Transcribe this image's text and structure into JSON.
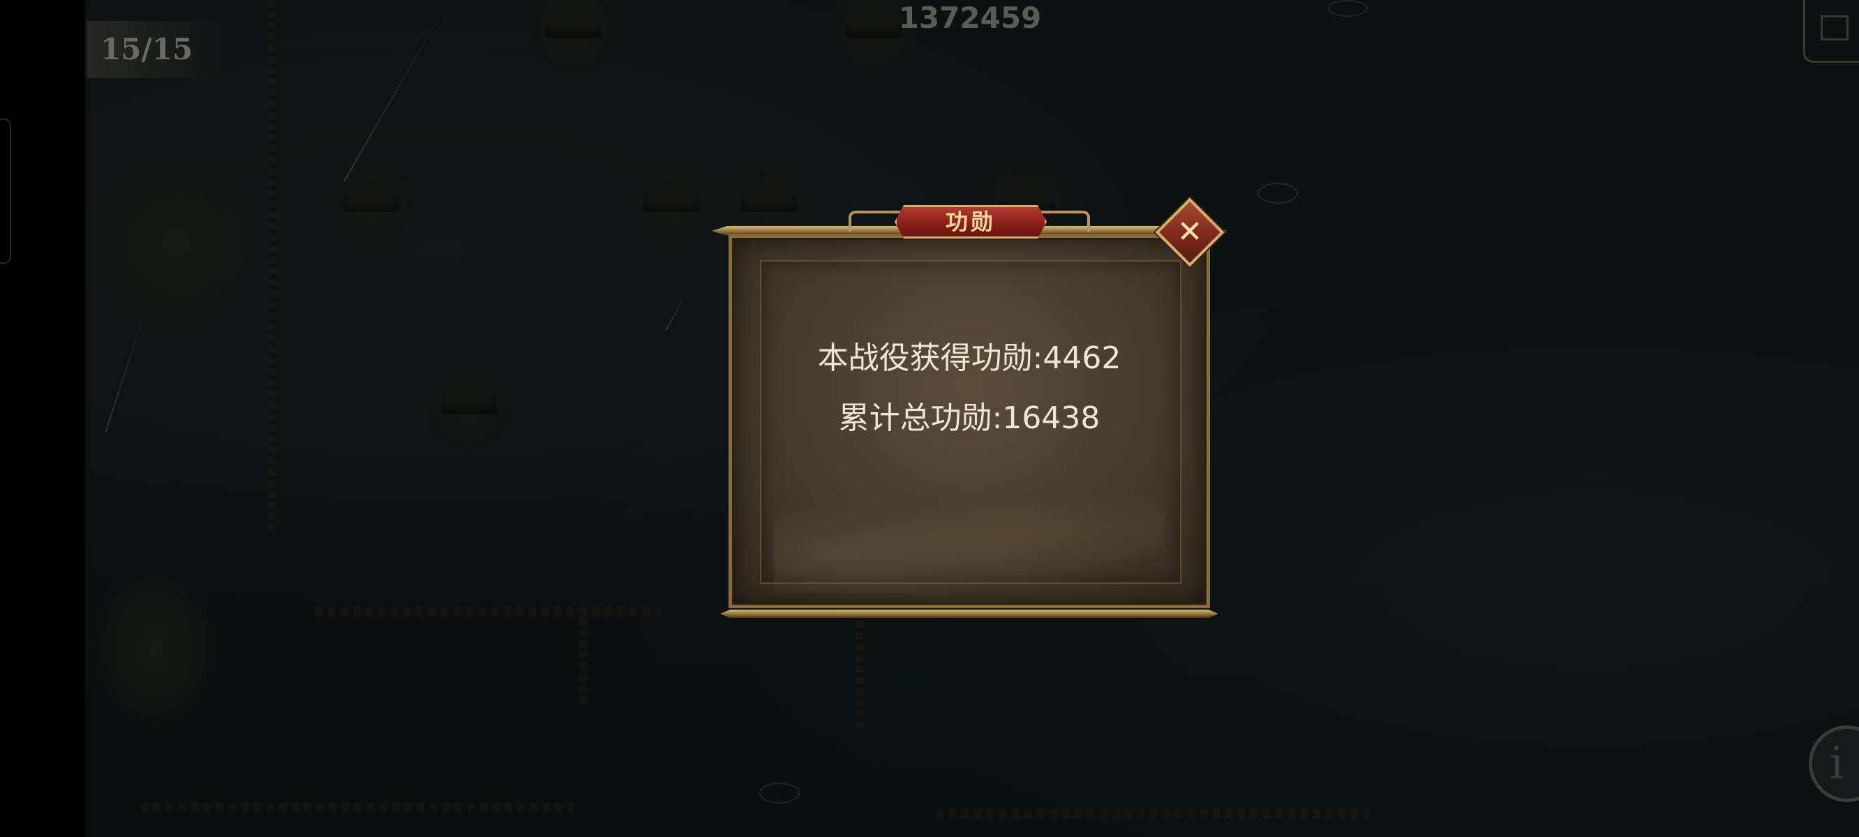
{
  "hud": {
    "progress_counter": "15/15",
    "score": "1372459",
    "info_button_label": "i"
  },
  "dialog": {
    "title": "功勋",
    "close_glyph": "✕",
    "lines": [
      "本战役获得功勋:4462",
      "累计总功勋:16438"
    ]
  },
  "colors": {
    "title_plate": "#8a1f18",
    "frame_gold": "#d6b06a",
    "panel_brown": "#453a2c",
    "text_light": "#efe6d4"
  }
}
